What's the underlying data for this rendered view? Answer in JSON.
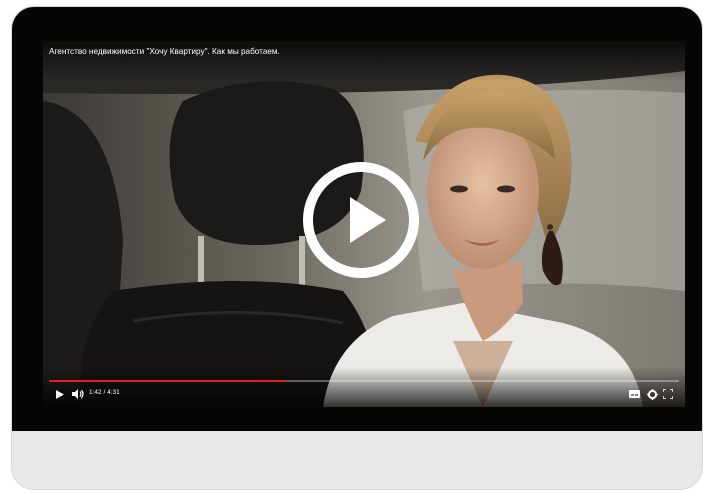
{
  "video": {
    "title": "Агентство недвижимости \"Хочу Квартиру\". Как мы работаем.",
    "current_time": "1:42",
    "duration": "4:31",
    "time_display": "1:42 / 4:31",
    "progress_fraction": 0.376
  },
  "colors": {
    "progress_accent": "#e62117",
    "bezel": "#050505",
    "chin": "#e8e8e9"
  },
  "icons": {
    "big_play": "play-icon",
    "play": "play-icon",
    "volume": "volume-icon",
    "subtitles": "subtitles-icon",
    "settings": "settings-icon",
    "fullscreen": "fullscreen-icon"
  }
}
